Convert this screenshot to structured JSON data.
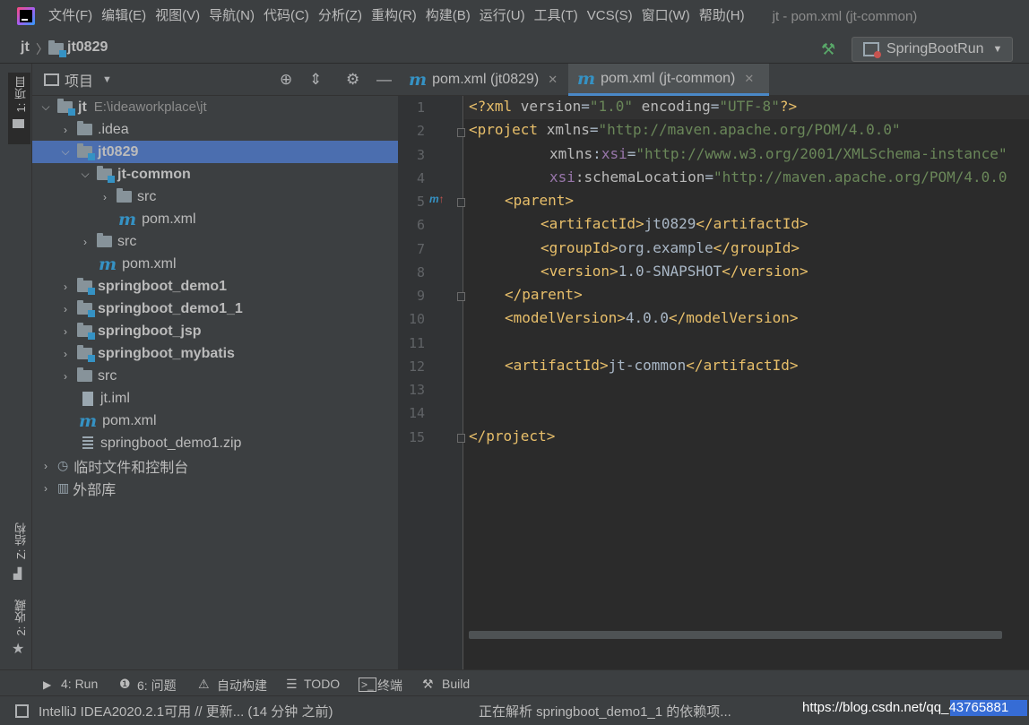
{
  "menubar": {
    "items": [
      "文件(F)",
      "编辑(E)",
      "视图(V)",
      "导航(N)",
      "代码(C)",
      "分析(Z)",
      "重构(R)",
      "构建(B)",
      "运行(U)",
      "工具(T)",
      "VCS(S)",
      "窗口(W)",
      "帮助(H)"
    ],
    "window_title": "jt - pom.xml (jt-common)"
  },
  "navbar": {
    "crumb1": "jt",
    "crumb2": "jt0829",
    "run_config": "SpringBootRun"
  },
  "left_strip": {
    "project": "1: 项目",
    "structure": "Z: 结构",
    "favorites": "2: 收藏"
  },
  "project_panel": {
    "title": "项目",
    "tree": [
      {
        "label": "jt",
        "path": "E:\\ideaworkplace\\jt"
      },
      {
        "label": ".idea"
      },
      {
        "label": "jt0829"
      },
      {
        "label": "jt-common"
      },
      {
        "label": "src"
      },
      {
        "label": "pom.xml"
      },
      {
        "label": "src"
      },
      {
        "label": "pom.xml"
      },
      {
        "label": "springboot_demo1"
      },
      {
        "label": "springboot_demo1_1"
      },
      {
        "label": "springboot_jsp"
      },
      {
        "label": "springboot_mybatis"
      },
      {
        "label": "src"
      },
      {
        "label": "jt.iml"
      },
      {
        "label": "pom.xml"
      },
      {
        "label": "springboot_demo1.zip"
      },
      {
        "label": "临时文件和控制台"
      },
      {
        "label": "外部库"
      }
    ]
  },
  "editor": {
    "tabs": [
      {
        "label": "pom.xml (jt0829)"
      },
      {
        "label": "pom.xml (jt-common)"
      }
    ],
    "line_numbers": [
      "1",
      "2",
      "3",
      "4",
      "5",
      "6",
      "7",
      "8",
      "9",
      "10",
      "11",
      "12",
      "13",
      "14",
      "15"
    ],
    "code": {
      "l1": {
        "a": "<?xml ",
        "b": "version",
        "c": "=",
        "d": "\"1.0\"",
        "e": " encoding",
        "f": "=",
        "g": "\"UTF-8\"",
        "h": "?>"
      },
      "l2": {
        "a": "<project ",
        "b": "xmlns",
        "c": "=",
        "d": "\"http://maven.apache.org/POM/4.0.0\""
      },
      "l3": {
        "a": "xmlns",
        "b": ":",
        "c": "xsi",
        "d": "=",
        "e": "\"http://www.w3.org/2001/XMLSchema-instance\""
      },
      "l4": {
        "a": "xsi",
        "b": ":schemaLocation",
        "c": "=",
        "d": "\"http://maven.apache.org/POM/4.0.0"
      },
      "l5": "<parent>",
      "l6": {
        "a": "<artifactId>",
        "b": "jt0829",
        "c": "</artifactId>"
      },
      "l7": {
        "a": "<groupId>",
        "b": "org.example",
        "c": "</groupId>"
      },
      "l8": {
        "a": "<version>",
        "b": "1.0-SNAPSHOT",
        "c": "</version>"
      },
      "l9": "</parent>",
      "l10": {
        "a": "<modelVersion>",
        "b": "4.0.0",
        "c": "</modelVersion>"
      },
      "l12": {
        "a": "<artifactId>",
        "b": "jt-common",
        "c": "</artifactId>"
      },
      "l15": "</project>"
    }
  },
  "bottom_tools": {
    "run": "4: Run",
    "problems": "6: 问题",
    "build_auto": "自动构建",
    "todo": "TODO",
    "terminal": "终端",
    "build": "Build"
  },
  "statusbar": {
    "message": "IntelliJ IDEA2020.2.1可用 // 更新... (14 分钟 之前)",
    "progress": "正在解析 springboot_demo1_1 的依赖项...",
    "watermark": "https://blog.csdn.net/qq_43765881"
  },
  "colors": {
    "accent": "#4a88c7",
    "selection": "#4b6eaf",
    "tag": "#e8bf6a",
    "string": "#6a8759",
    "namespace": "#9876aa"
  }
}
